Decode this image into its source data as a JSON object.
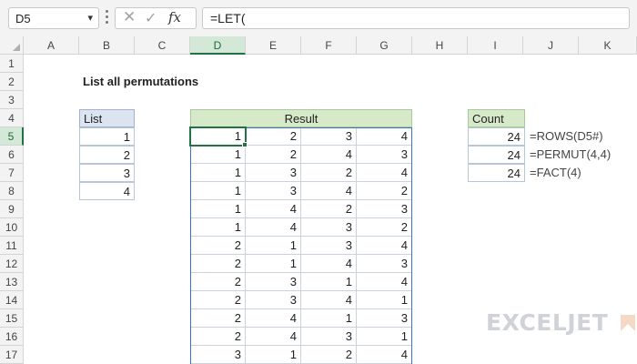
{
  "formula_bar": {
    "name_box": "D5",
    "name_box_caret": "▾",
    "cancel_glyph": "✕",
    "enter_glyph": "✓",
    "fx_label": "fx",
    "formula": "=LET("
  },
  "columns": [
    "A",
    "B",
    "C",
    "D",
    "E",
    "F",
    "G",
    "H",
    "I",
    "J",
    "K"
  ],
  "rows": [
    "1",
    "2",
    "3",
    "4",
    "5",
    "6",
    "7",
    "8",
    "9",
    "10",
    "11",
    "12",
    "13",
    "14",
    "15",
    "16",
    "17"
  ],
  "selected_column": "D",
  "selected_row": "5",
  "title": "List all permutations",
  "list": {
    "header": "List",
    "values": [
      "1",
      "2",
      "3",
      "4"
    ]
  },
  "result": {
    "header": "Result",
    "rows": [
      [
        "1",
        "2",
        "3",
        "4"
      ],
      [
        "1",
        "2",
        "4",
        "3"
      ],
      [
        "1",
        "3",
        "2",
        "4"
      ],
      [
        "1",
        "3",
        "4",
        "2"
      ],
      [
        "1",
        "4",
        "2",
        "3"
      ],
      [
        "1",
        "4",
        "3",
        "2"
      ],
      [
        "2",
        "1",
        "3",
        "4"
      ],
      [
        "2",
        "1",
        "4",
        "3"
      ],
      [
        "2",
        "3",
        "1",
        "4"
      ],
      [
        "2",
        "3",
        "4",
        "1"
      ],
      [
        "2",
        "4",
        "1",
        "3"
      ],
      [
        "2",
        "4",
        "3",
        "1"
      ],
      [
        "3",
        "1",
        "2",
        "4"
      ]
    ]
  },
  "count": {
    "header": "Count",
    "values": [
      "24",
      "24",
      "24"
    ],
    "formulas": [
      "=ROWS(D5#)",
      "=PERMUT(4,4)",
      "=FACT(4)"
    ]
  },
  "watermark": "EXCELJET",
  "colors": {
    "accent_green": "#217346",
    "spill_blue": "#3a73c8",
    "list_header_bg": "#dbe4f0",
    "result_header_bg": "#d6e9c9"
  },
  "icons": {
    "cancel": "close-icon",
    "enter": "check-icon",
    "function": "fx-icon",
    "dropdown": "chevron-down-icon"
  }
}
